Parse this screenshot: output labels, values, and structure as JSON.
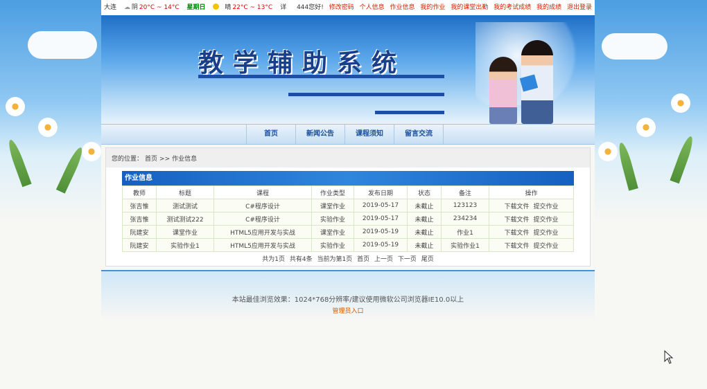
{
  "topbar": {
    "city": "大连",
    "weather1_desc": "阴",
    "weather1_temp": "20°C ~ 14°C",
    "weekday": "星期日",
    "weather2_desc": "晴",
    "weather2_temp": "22°C ~ 13°C",
    "more": "详",
    "greeting": "444您好!",
    "links": [
      "修改密码",
      "个人信息",
      "作业信息",
      "我的作业",
      "我的课堂出勤",
      "我的考试成绩",
      "我的成绩",
      "退出登录"
    ]
  },
  "banner": {
    "title": "教学辅助系统"
  },
  "nav": {
    "items": [
      "首页",
      "新闻公告",
      "课程须知",
      "留言交流"
    ]
  },
  "breadcrumb": {
    "label": "您的位置：",
    "home": "首页",
    "sep": ">>",
    "current": "作业信息"
  },
  "panel": {
    "title": "作业信息",
    "headers": [
      "教师",
      "标题",
      "课程",
      "作业类型",
      "发布日期",
      "状态",
      "备注",
      "操作"
    ],
    "rows": [
      {
        "teacher": "张吉惟",
        "title": "测试测试",
        "course": "C#程序设计",
        "type": "课堂作业",
        "date": "2019-05-17",
        "status": "未截止",
        "note": "123123"
      },
      {
        "teacher": "张吉惟",
        "title": "测试测试222",
        "course": "C#程序设计",
        "type": "实验作业",
        "date": "2019-05-17",
        "status": "未截止",
        "note": "234234"
      },
      {
        "teacher": "阮建安",
        "title": "课堂作业",
        "course": "HTML5应用开发与实战",
        "type": "课堂作业",
        "date": "2019-05-19",
        "status": "未截止",
        "note": "作业1"
      },
      {
        "teacher": "阮建安",
        "title": "实验作业1",
        "course": "HTML5应用开发与实战",
        "type": "实验作业",
        "date": "2019-05-19",
        "status": "未截止",
        "note": "实验作业1"
      }
    ],
    "op_download": "下载文件",
    "op_submit": "提交作业"
  },
  "pager": {
    "total_pages": "共为1页",
    "total_items": "共有4条",
    "current": "当前为第1页",
    "first": "首页",
    "prev": "上一页",
    "next": "下一页",
    "last": "尾页"
  },
  "footer": {
    "note": "本站最佳浏览效果：1024*768分辨率/建议使用微软公司浏览器IE10.0以上",
    "admin": "管理员入口"
  }
}
